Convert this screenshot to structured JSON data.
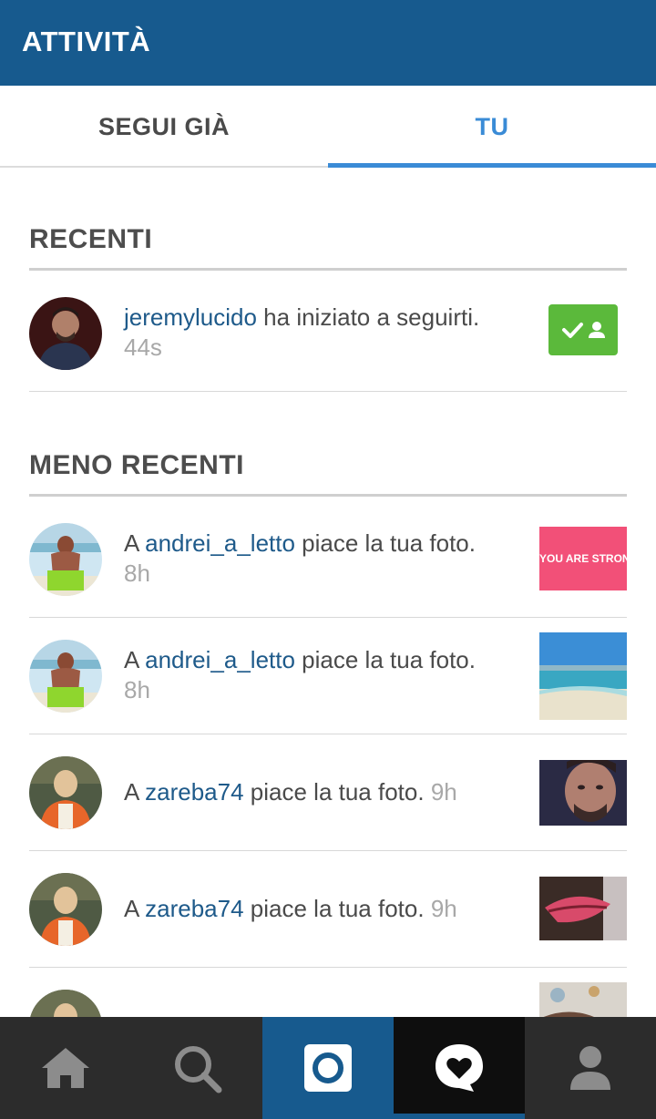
{
  "header": {
    "title": "ATTIVITÀ"
  },
  "tabs": [
    {
      "label": "SEGUI GIÀ"
    },
    {
      "label": "TU"
    }
  ],
  "sections": {
    "recent": {
      "title": "RECENTI",
      "item": {
        "username": "jeremylucido",
        "action": " ha iniziato a seguirti.",
        "time": "44s"
      }
    },
    "older": {
      "title": "MENO RECENTI",
      "items": [
        {
          "prefix": "A ",
          "username": "andrei_a_letto",
          "action": " piace la tua foto.",
          "time": "8h",
          "thumb_text": "YOU ARE STRONG."
        },
        {
          "prefix": "A ",
          "username": "andrei_a_letto",
          "action": " piace la tua foto.",
          "time": "8h"
        },
        {
          "prefix": "A ",
          "username": "zareba74",
          "action": " piace la tua foto.",
          "time": "9h"
        },
        {
          "prefix": "A ",
          "username": "zareba74",
          "action": " piace la tua foto.",
          "time": "9h"
        }
      ]
    }
  },
  "bottom_nav": [
    "home-icon",
    "search-icon",
    "camera-icon",
    "activity-heart-icon",
    "profile-icon"
  ],
  "colors": {
    "header": "#175a8e",
    "accent": "#3a8bd6",
    "follow_green": "#5bb93b",
    "username": "#1e5a8a"
  }
}
